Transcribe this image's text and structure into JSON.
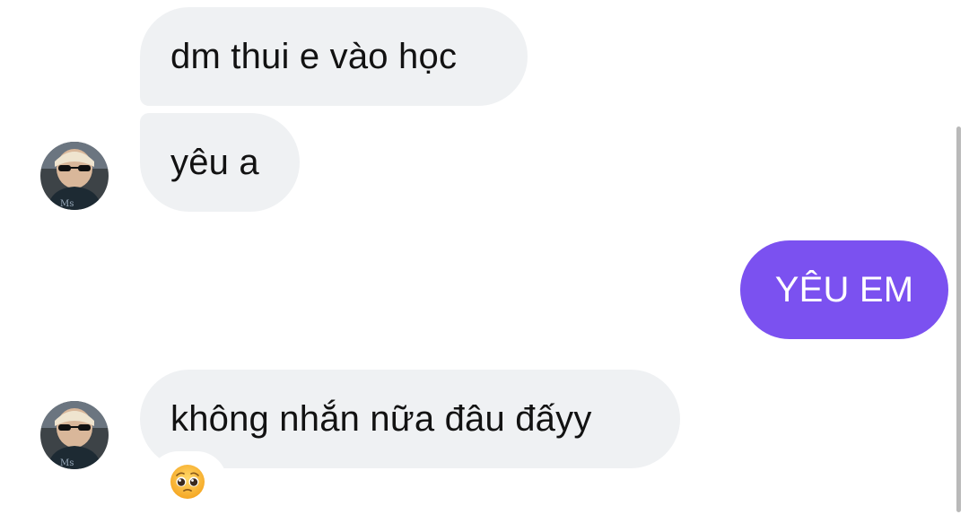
{
  "messages": [
    {
      "text": "dm thui e vào học"
    },
    {
      "text": "yêu a"
    },
    {
      "text": "YÊU EM"
    },
    {
      "text": "không nhắn nữa đâu đấyy"
    }
  ],
  "reaction": {
    "emoji": "🥺"
  },
  "colors": {
    "incoming_bubble": "#eff1f3",
    "outgoing_bubble": "#7b51f0",
    "text": "#121212"
  },
  "icons": {
    "avatar": "contact-avatar-icon",
    "reaction": "pleading-face-icon"
  }
}
